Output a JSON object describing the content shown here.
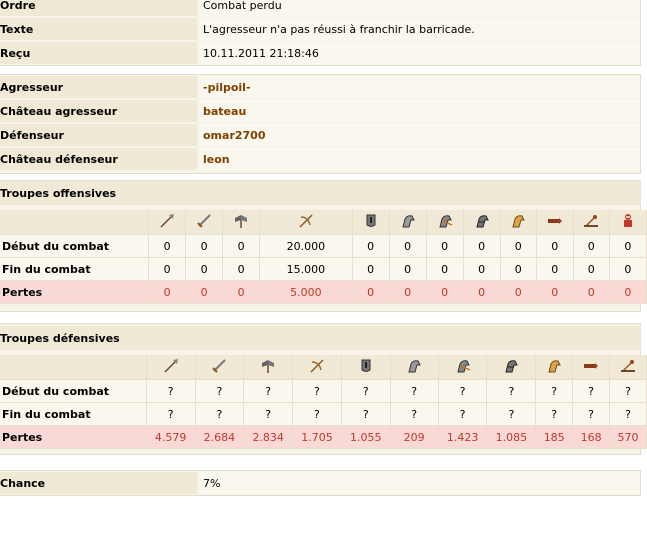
{
  "report": {
    "order_label": "Ordre",
    "order_value": "Combat perdu",
    "text_label": "Texte",
    "text_value": "L'agresseur n'a pas réussi à franchir la barricade.",
    "received_label": "Reçu",
    "received_value": "10.11.2011 21:18:46"
  },
  "parties": {
    "attacker_label": "Agresseur",
    "attacker_value": "-pilpoil-",
    "attacker_castle_label": "Château agresseur",
    "attacker_castle_value": "bateau",
    "defender_label": "Défenseur",
    "defender_value": "omar2700",
    "defender_castle_label": "Château défenseur",
    "defender_castle_value": "leon"
  },
  "offense": {
    "title": "Troupes offensives",
    "icons": [
      "spear-icon",
      "sword-icon",
      "axe-icon",
      "crossbow-icon",
      "armored-foot-icon",
      "horse-icon",
      "lancer-horse-icon",
      "heavy-horse-icon",
      "golden-horse-icon",
      "ram-icon",
      "catapult-icon",
      "knight-icon"
    ],
    "rows": [
      {
        "label": "Début du combat",
        "values": [
          "0",
          "0",
          "0",
          "20.000",
          "0",
          "0",
          "0",
          "0",
          "0",
          "0",
          "0",
          "0"
        ]
      },
      {
        "label": "Fin du combat",
        "values": [
          "0",
          "0",
          "0",
          "15.000",
          "0",
          "0",
          "0",
          "0",
          "0",
          "0",
          "0",
          "0"
        ]
      },
      {
        "label": "Pertes",
        "values": [
          "0",
          "0",
          "0",
          "5.000",
          "0",
          "0",
          "0",
          "0",
          "0",
          "0",
          "0",
          "0"
        ]
      }
    ]
  },
  "defense": {
    "title": "Troupes défensives",
    "icons": [
      "spear-icon",
      "sword-icon",
      "axe-icon",
      "crossbow-icon",
      "armored-foot-icon",
      "horse-icon",
      "lancer-horse-icon",
      "heavy-horse-icon",
      "golden-horse-icon",
      "ram-icon",
      "catapult-icon"
    ],
    "rows": [
      {
        "label": "Début du combat",
        "values": [
          "?",
          "?",
          "?",
          "?",
          "?",
          "?",
          "?",
          "?",
          "?",
          "?",
          "?"
        ]
      },
      {
        "label": "Fin du combat",
        "values": [
          "?",
          "?",
          "?",
          "?",
          "?",
          "?",
          "?",
          "?",
          "?",
          "?",
          "?"
        ]
      },
      {
        "label": "Pertes",
        "values": [
          "4.579",
          "2.684",
          "2.834",
          "1.705",
          "1.055",
          "209",
          "1.423",
          "1.085",
          "185",
          "168",
          "570"
        ]
      }
    ]
  },
  "chance": {
    "label": "Chance",
    "value": "7%"
  }
}
